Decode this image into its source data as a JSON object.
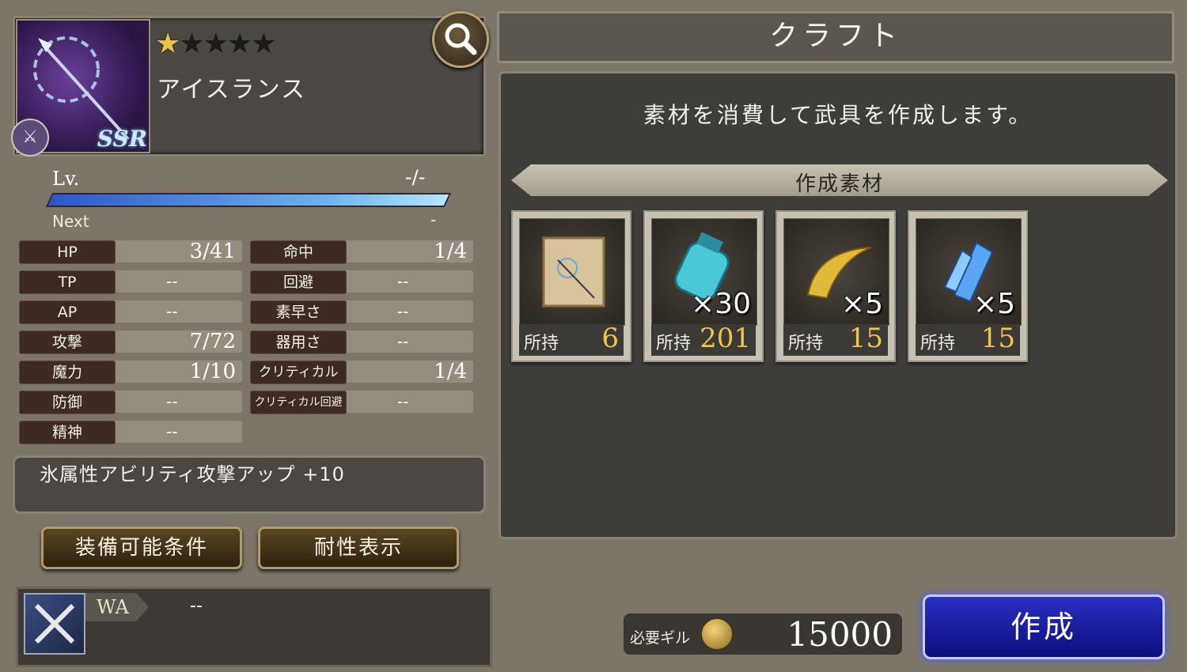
{
  "weapon": {
    "name": "アイスランス",
    "rarity_badge": "SSR",
    "stars_total": 5,
    "stars_filled": 1,
    "type_icon": "spear-icon"
  },
  "level": {
    "label": "Lv.",
    "value": "-/-",
    "next_label": "Next",
    "next_value": "-"
  },
  "stats_left": [
    {
      "label": "HP",
      "value": "3/41"
    },
    {
      "label": "TP",
      "value": "--"
    },
    {
      "label": "AP",
      "value": "--"
    },
    {
      "label": "攻撃",
      "value": "7/72"
    },
    {
      "label": "魔力",
      "value": "1/10"
    },
    {
      "label": "防御",
      "value": "--"
    },
    {
      "label": "精神",
      "value": "--"
    }
  ],
  "stats_right": [
    {
      "label": "命中",
      "value": "1/4"
    },
    {
      "label": "回避",
      "value": "--"
    },
    {
      "label": "素早さ",
      "value": "--"
    },
    {
      "label": "器用さ",
      "value": "--"
    },
    {
      "label": "クリティカル",
      "value": "1/4"
    },
    {
      "label": "クリティカル回避",
      "value": "--"
    }
  ],
  "ability": "氷属性アビリティ攻撃アップ +10",
  "buttons": {
    "equip_conditions": "装備可能条件",
    "resistance": "耐性表示",
    "create": "作成"
  },
  "wa": {
    "label": "WA",
    "value": "--"
  },
  "craft": {
    "title": "クラフト",
    "description": "素材を消費して武具を作成します。",
    "materials_header": "作成素材",
    "owned_label": "所持",
    "materials": [
      {
        "icon": "scroll-icon",
        "qty": "",
        "owned": "6"
      },
      {
        "icon": "potion-jar-icon",
        "qty": "×30",
        "owned": "201"
      },
      {
        "icon": "golden-horn-icon",
        "qty": "×5",
        "owned": "15"
      },
      {
        "icon": "ice-crystal-icon",
        "qty": "×5",
        "owned": "15"
      }
    ],
    "gil_label": "必要ギル",
    "gil_value": "15000"
  },
  "colors": {
    "accent_blue": "#1a1fa8",
    "gold": "#f2c34c",
    "panel_dark": "#3f3d3a"
  }
}
